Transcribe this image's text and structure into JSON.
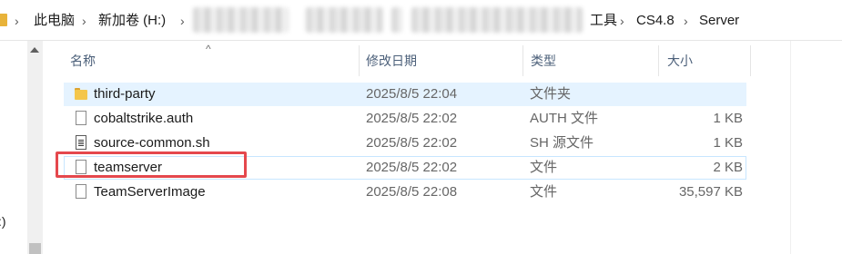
{
  "breadcrumb": {
    "items": [
      {
        "label": "此电脑"
      },
      {
        "label": "新加卷 (H:)"
      },
      {
        "label": "工具"
      },
      {
        "label": "CS4.8"
      },
      {
        "label": "Server"
      }
    ],
    "separator": "›"
  },
  "columns": [
    {
      "label": "名称"
    },
    {
      "label": "修改日期"
    },
    {
      "label": "类型"
    },
    {
      "label": "大小"
    }
  ],
  "files": [
    {
      "name": "third-party",
      "date": "2025/8/5 22:04",
      "type": "文件夹",
      "size": "",
      "icon": "folder-icon",
      "selected": true
    },
    {
      "name": "cobaltstrike.auth",
      "date": "2025/8/5 22:02",
      "type": "AUTH 文件",
      "size": "1 KB",
      "icon": "file-icon",
      "selected": false
    },
    {
      "name": "source-common.sh",
      "date": "2025/8/5 22:02",
      "type": "SH 源文件",
      "size": "1 KB",
      "icon": "script-file-icon",
      "selected": false
    },
    {
      "name": "teamserver",
      "date": "2025/8/5 22:02",
      "type": "文件",
      "size": "2 KB",
      "icon": "file-icon",
      "selected": false,
      "highlighted": true
    },
    {
      "name": "TeamServerImage",
      "date": "2025/8/5 22:08",
      "type": "文件",
      "size": "35,597 KB",
      "icon": "file-icon",
      "selected": false
    }
  ],
  "nav": {
    "partial_label": ":)"
  },
  "colors": {
    "selection": "#e5f3ff",
    "highlight_box": "#e5484d",
    "header_text": "#4c607a",
    "folder": "#f4c64b"
  }
}
